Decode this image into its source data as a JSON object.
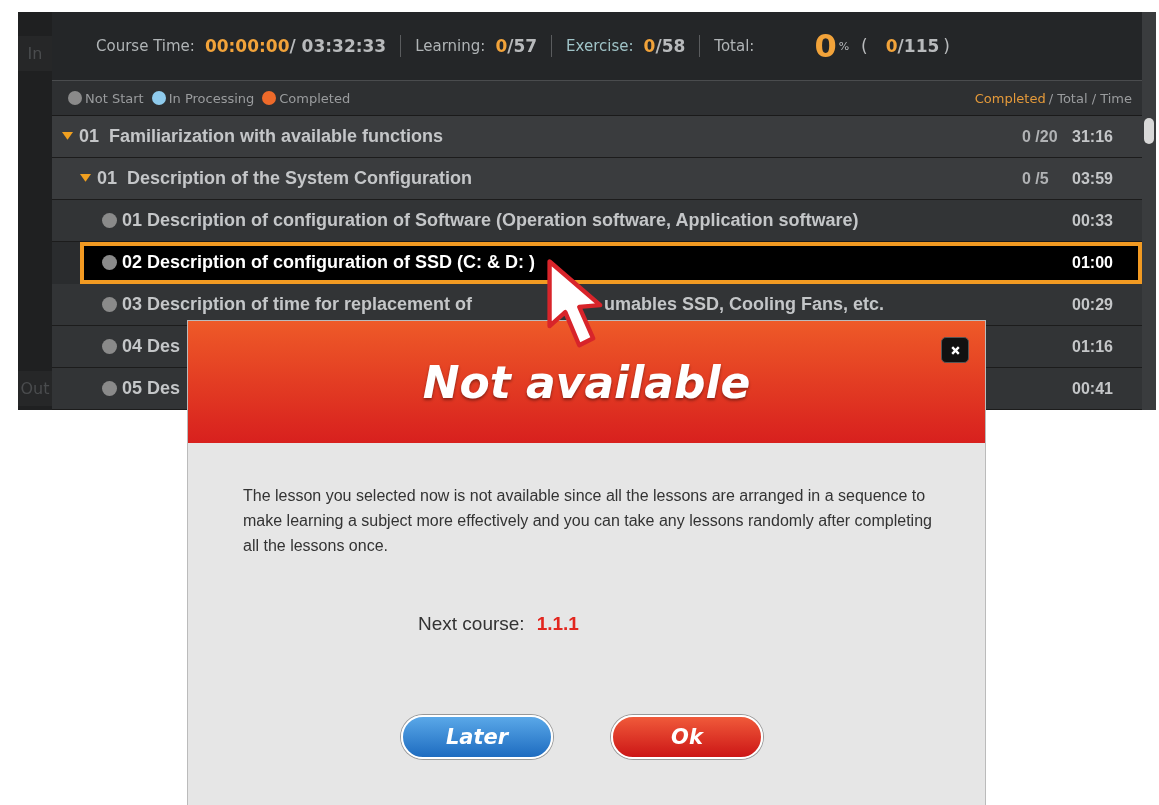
{
  "side_buttons": [
    {
      "label": "In"
    },
    {
      "label": "Out"
    }
  ],
  "stats": {
    "course_time_label": "Course Time:",
    "elapsed": "00:00:00",
    "course_total": "/ 03:32:33",
    "learning_label": "Learning:",
    "learning_done": "0",
    "learning_total": "/57",
    "exercise_label": "Exercise:",
    "exercise_done": "0",
    "exercise_total": "/58",
    "total_label": "Total:",
    "percent": "0",
    "percent_sign": "%",
    "open_paren": "(",
    "total_done": "0",
    "total_count": "/115",
    "close_paren": ")"
  },
  "legend": [
    {
      "label": "Not Start",
      "color": "#8a8a8a"
    },
    {
      "label": "In Processing",
      "color": "#8fcbed"
    },
    {
      "label": "Completed",
      "color": "#ee6a2a"
    }
  ],
  "column_header": {
    "completed": "Completed",
    "rest": "/ Total / Time"
  },
  "tree": [
    {
      "number": "01",
      "title": "Familiarization with available functions",
      "progress": "0 /20",
      "time": "31:16",
      "expanded": true,
      "children": [
        {
          "number": "01",
          "title": "Description of the System Configuration",
          "progress": "0 /5",
          "time": "03:59",
          "expanded": true,
          "children": [
            {
              "title_parts": [
                "01 Description of configuration of Software (Operation software, Application software)"
              ],
              "time": "00:33",
              "color": "#8a8a8a",
              "selected": false
            },
            {
              "title_parts": [
                "02 Description of configuration of SSD (C: & D: )"
              ],
              "time": "01:00",
              "color": "#8a8a8a",
              "selected": true
            },
            {
              "title_parts": [
                "03 Description of time for replacement of",
                "umables SSD, Cooling Fans, etc."
              ],
              "time": "00:29",
              "color": "#8a8a8a",
              "selected": false
            },
            {
              "title_parts": [
                "04 Des"
              ],
              "time": "01:16",
              "color": "#8a8a8a",
              "selected": false
            },
            {
              "title_parts": [
                "05 Des"
              ],
              "time": "00:41",
              "color": "#8a8a8a",
              "selected": false
            }
          ]
        }
      ]
    }
  ],
  "dialog": {
    "title": "Not available",
    "message": "The lesson you selected now is not available since all the lessons are arranged in a sequence to make learning a subject more effectively and you can take any lessons randomly after completing all the lessons once.",
    "next_label": "Next course:",
    "next_value": "1.1.1",
    "buttons": [
      {
        "label": "Later",
        "kind": "secondary"
      },
      {
        "label": "Ok",
        "kind": "primary"
      }
    ]
  }
}
